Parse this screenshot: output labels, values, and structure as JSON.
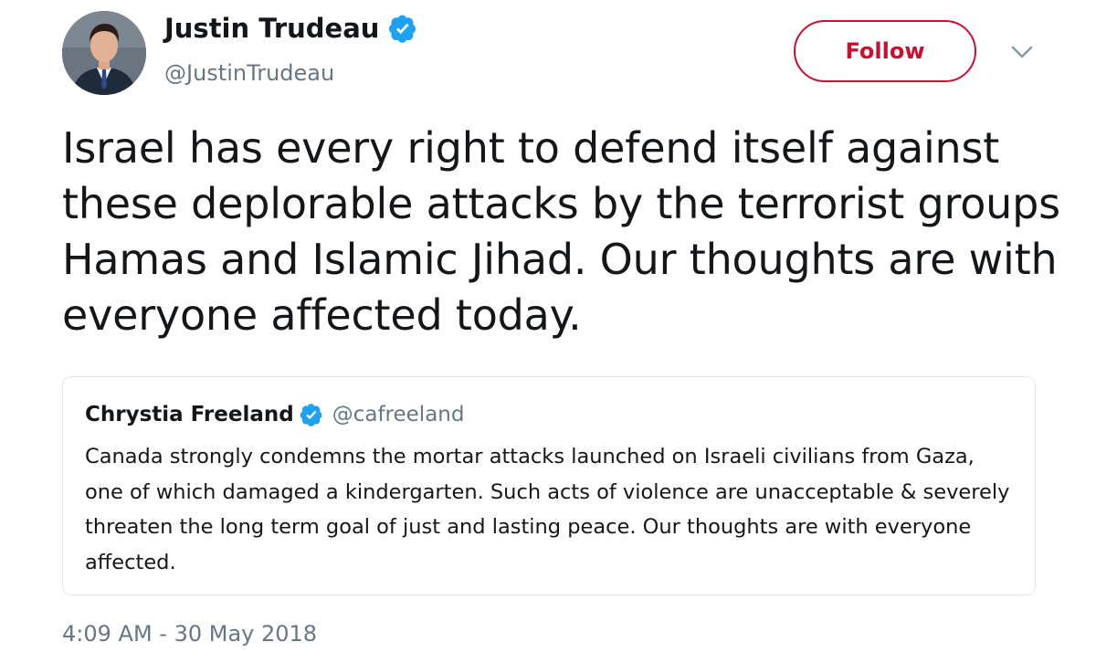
{
  "author": {
    "name": "Justin Trudeau",
    "handle": "@JustinTrudeau",
    "verified_icon": "verified-badge-icon"
  },
  "follow_label": "Follow",
  "tweet_text": "Israel has every right to defend itself against these deplorable attacks by the terrorist groups Hamas and Islamic Jihad. Our thoughts are with everyone affected today.",
  "quoted_tweet": {
    "name": "Chrystia Freeland",
    "handle": "@cafreeland",
    "text": "Canada strongly condemns the mortar attacks launched on Israeli civilians from Gaza, one of which damaged a kindergarten. Such acts of violence are unacceptable & severely threaten the long term goal of just and lasting peace. Our thoughts are with everyone affected."
  },
  "timestamp": "4:09 AM - 30 May 2018",
  "colors": {
    "follow_accent": "#c8102e",
    "verified_blue": "#1da1f2",
    "secondary_text": "#657786",
    "border": "#e1e8ed"
  }
}
